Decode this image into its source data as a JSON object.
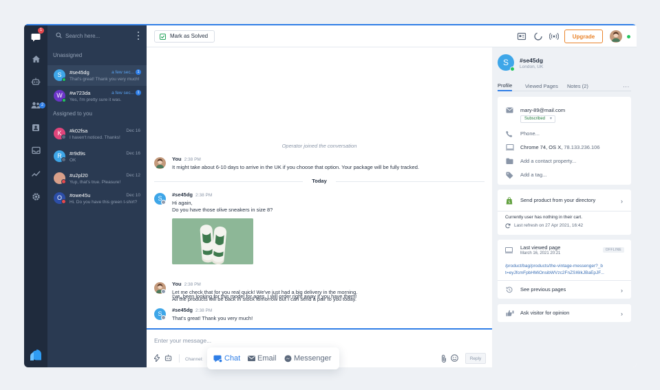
{
  "rail": {
    "chat_badge": "1",
    "team_badge": "2",
    "colors": {
      "background": "#1f2b3d",
      "badge_red": "#e5484d",
      "badge_blue": "#2f7ee6"
    },
    "icons": [
      "chat-icon",
      "home-icon",
      "bot-icon",
      "team-icon",
      "contacts-icon",
      "inbox-icon",
      "reports-icon",
      "settings-icon",
      "logo-icon"
    ]
  },
  "sidebar": {
    "search_placeholder": "Search here...",
    "unassigned_label": "Unassigned",
    "assigned_label": "Assigned to you",
    "unassigned": [
      {
        "initial": "S",
        "name": "#se45dg",
        "preview": "That's great! Thank you very much!",
        "time": "a few sec...",
        "count": "1",
        "color": "#3ea6e8",
        "active": true
      },
      {
        "initial": "W",
        "name": "#w723da",
        "preview": "Yes, I'm pretty sure it was.",
        "time": "a few sec...",
        "count": "1",
        "color": "#6c35c9",
        "active": false
      }
    ],
    "assigned": [
      {
        "initial": "K",
        "name": "#k02fsa",
        "preview": "I haven't noticed. Thanks!",
        "time": "Dec 16",
        "color": "#e0457b"
      },
      {
        "initial": "R",
        "name": "#r9d9s",
        "preview": "OK",
        "time": "Dec 16",
        "color": "#3ea6e8"
      },
      {
        "initial": "",
        "name": "#u2pl20",
        "preview": "Yup, that's true. Pleasure!",
        "time": "Dec 12",
        "color": "#d9a08a"
      },
      {
        "initial": "O",
        "name": "#owe45u",
        "preview": "Hi. Do you have this green t-shirt?",
        "time": "Dec 10",
        "color": "#2c4ea8"
      }
    ]
  },
  "toolbar": {
    "solved_label": "Mark as Solved",
    "upgrade_label": "Upgrade",
    "accent": "#2f7ee6",
    "upgrade_color": "#e9832a"
  },
  "chat": {
    "system_message": "Operator joined the conversation",
    "day_label": "Today",
    "messages": [
      {
        "author": "You",
        "time": "2:38 PM",
        "lines": [
          "It might take about 6-10 days to arrive in the UK if you choose that option. Your package will be fully tracked."
        ]
      },
      {
        "author": "#se45dg",
        "time": "2:38 PM",
        "lines": [
          "Hi again,",
          "Do you have those olive sneakers in size 8?"
        ],
        "after_image": "I've, been looking for this model for ages. I will order right away if you have them!"
      },
      {
        "author": "You",
        "time": "2:38 PM",
        "lines": [
          "Let me check that for you real quick! We've just had a big delivery in the morning.",
          "All the products will be back in stock tomorrow but I can send a pair to you today."
        ]
      },
      {
        "author": "#se45dg",
        "time": "2:38 PM",
        "lines": [
          "That's great! Thank you very much!"
        ]
      }
    ],
    "visitor_initial": "S"
  },
  "composer": {
    "placeholder": "Enter your message...",
    "channel_label": "Channel:",
    "reply_label": "Reply",
    "channels": [
      {
        "label": "Chat",
        "active": true
      },
      {
        "label": "Email",
        "active": false
      },
      {
        "label": "Messenger",
        "active": false
      }
    ]
  },
  "visitor": {
    "initial": "S",
    "name": "#se45dg",
    "location": "London, UK",
    "tabs": [
      "Profile",
      "Viewed Pages",
      "Notes (2)"
    ],
    "more": "...",
    "email": "mary-89@mail.com",
    "subscription": "Subscribed",
    "phone_placeholder": "Phone...",
    "browser": "Chrome 74, OS X,",
    "ip": "78.133.236.106",
    "contact_property": "Add a contact property...",
    "tag": "Add a tag...",
    "send_product": "Send product from your directory",
    "cart_status": "Currently user has nothing in their cart.",
    "last_refresh": "Last refresh on 27 Apr 2021, 16:42",
    "last_viewed_label": "Last viewed page",
    "last_viewed_date": "March 16, 2021 20:21",
    "offline_label": "OFFLINE",
    "page_url_1": "/product/bag/products/the-vintage-messenger?_b",
    "page_url_2": "t=eyJfcmFpbHMiOnsibWVzc2FnZSI6IkJBaEpJF...",
    "previous_pages": "See previous pages",
    "opinion": "Ask visitor for opinion"
  }
}
